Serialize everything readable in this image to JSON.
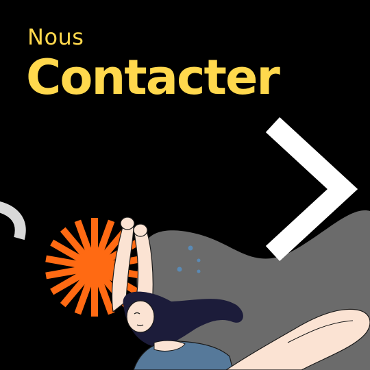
{
  "title": {
    "line1": "Nous",
    "line2": "Contacter"
  },
  "colors": {
    "background": "#000000",
    "accent_yellow": "#FFD84D",
    "sunburst_orange": "#FF6A13",
    "blob_gray": "#6B6B6B",
    "hook_gray": "#D9D9D9",
    "chevron_white": "#FFFFFF",
    "skin": "#FBE3D3",
    "hair": "#1C1C3A",
    "swimsuit": "#56799A"
  },
  "icons": [
    "chevron-right-icon",
    "sunburst-icon",
    "swimmer-illustration"
  ]
}
